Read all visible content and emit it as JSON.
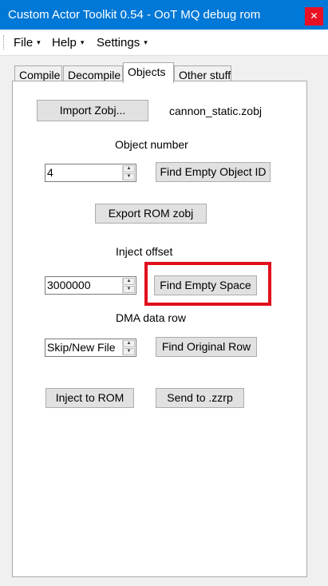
{
  "window": {
    "title": "Custom Actor Toolkit 0.54 - OoT MQ debug rom",
    "close_glyph": "✕"
  },
  "menu": [
    {
      "label": "File",
      "caret": "▾"
    },
    {
      "label": "Help",
      "caret": "▾"
    },
    {
      "label": "Settings",
      "caret": "▾"
    }
  ],
  "tabs": [
    {
      "label": "Compile",
      "active": false
    },
    {
      "label": "Decompile",
      "active": false
    },
    {
      "label": "Objects",
      "active": true
    },
    {
      "label": "Other stuff",
      "active": false
    }
  ],
  "objects": {
    "import_button": "Import Zobj...",
    "imported_file": "cannon_static.zobj",
    "object_number_label": "Object number",
    "object_number_value": "4",
    "find_empty_object_id_button": "Find Empty Object ID",
    "export_rom_zobj_button": "Export ROM zobj",
    "inject_offset_label": "Inject offset",
    "inject_offset_value": "3000000",
    "find_empty_space_button": "Find Empty Space",
    "dma_row_label": "DMA data row",
    "dma_row_value": "Skip/New File",
    "find_original_row_button": "Find Original Row",
    "inject_to_rom_button": "Inject to ROM",
    "send_to_zzrp_button": "Send to .zzrp"
  },
  "colors": {
    "titlebar": "#0078d7",
    "close": "#e81123",
    "highlight": "#e20f1c"
  }
}
